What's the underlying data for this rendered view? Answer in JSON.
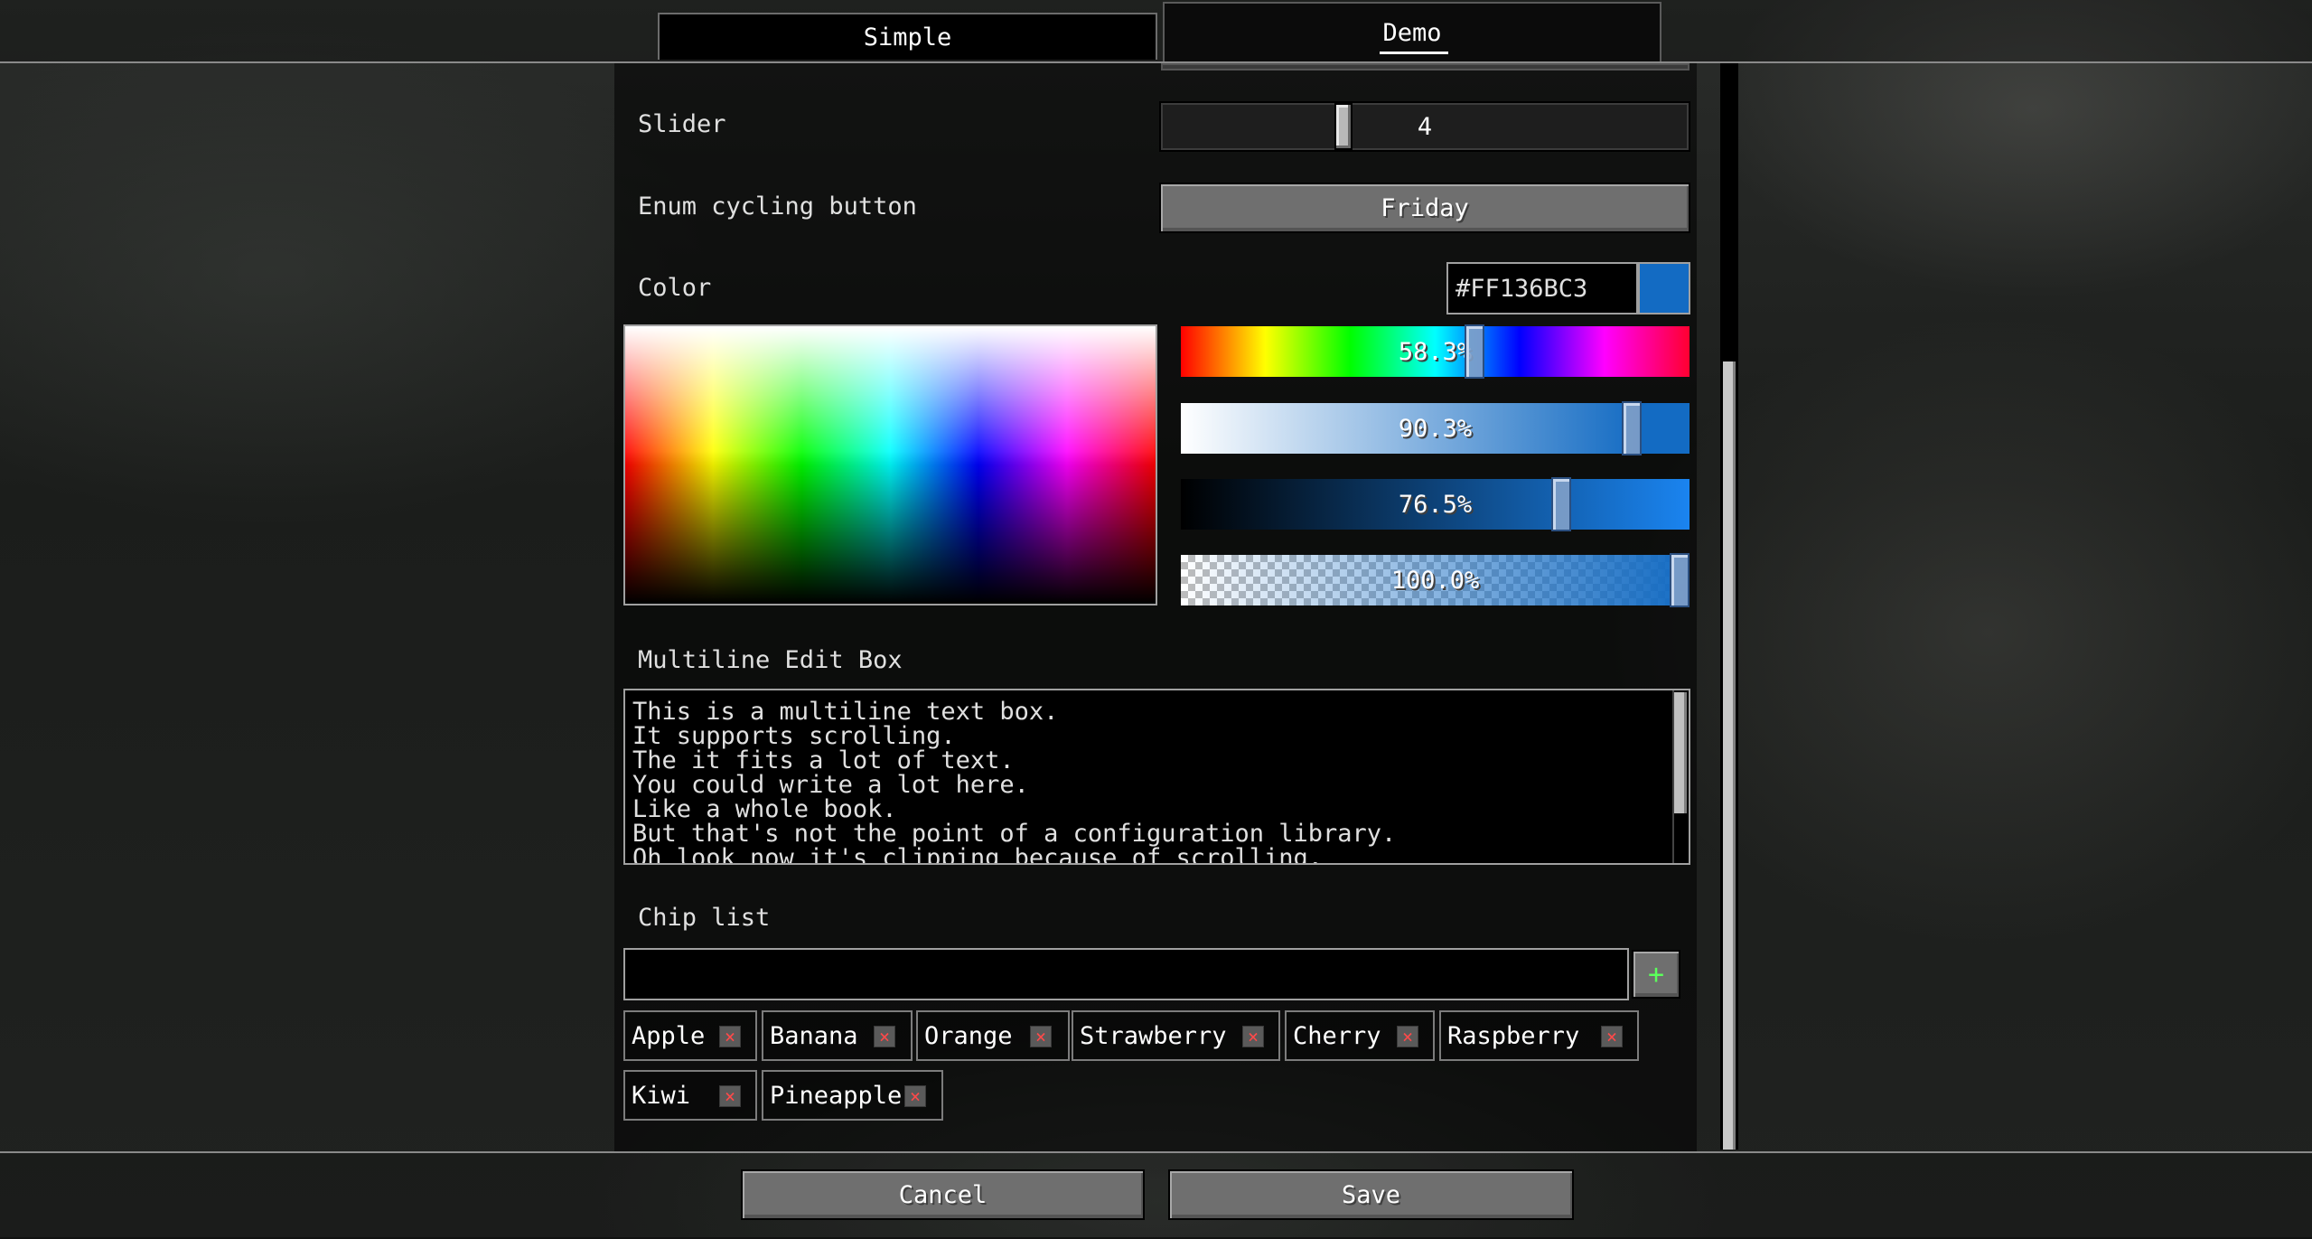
{
  "tabs": [
    {
      "label": "Simple",
      "selected": false
    },
    {
      "label": "Demo",
      "selected": true
    }
  ],
  "slider": {
    "label": "Slider",
    "value": "4"
  },
  "enum_button": {
    "label": "Enum cycling button",
    "value": "Friday"
  },
  "color": {
    "label": "Color",
    "hex": "#FF136BC3",
    "swatch": "#136BC3",
    "hue": "58.3%",
    "saturation": "90.3%",
    "brightness": "76.5%",
    "alpha": "100.0%"
  },
  "multiline": {
    "label": "Multiline Edit Box",
    "lines": [
      "This is a multiline text box.",
      "It supports scrolling.",
      "The it fits a lot of text.",
      "You could write a lot here.",
      "Like a whole book.",
      "But that's not the point of a configuration library.",
      "Oh look now it's clipping because of scrolling."
    ]
  },
  "chip_list": {
    "label": "Chip list",
    "input_value": "",
    "add_symbol": "+",
    "remove_symbol": "×",
    "chips": [
      "Apple",
      "Banana",
      "Orange",
      "Strawberry",
      "Cherry",
      "Raspberry",
      "Kiwi",
      "Pineapple"
    ]
  },
  "footer": {
    "cancel": "Cancel",
    "save": "Save"
  }
}
